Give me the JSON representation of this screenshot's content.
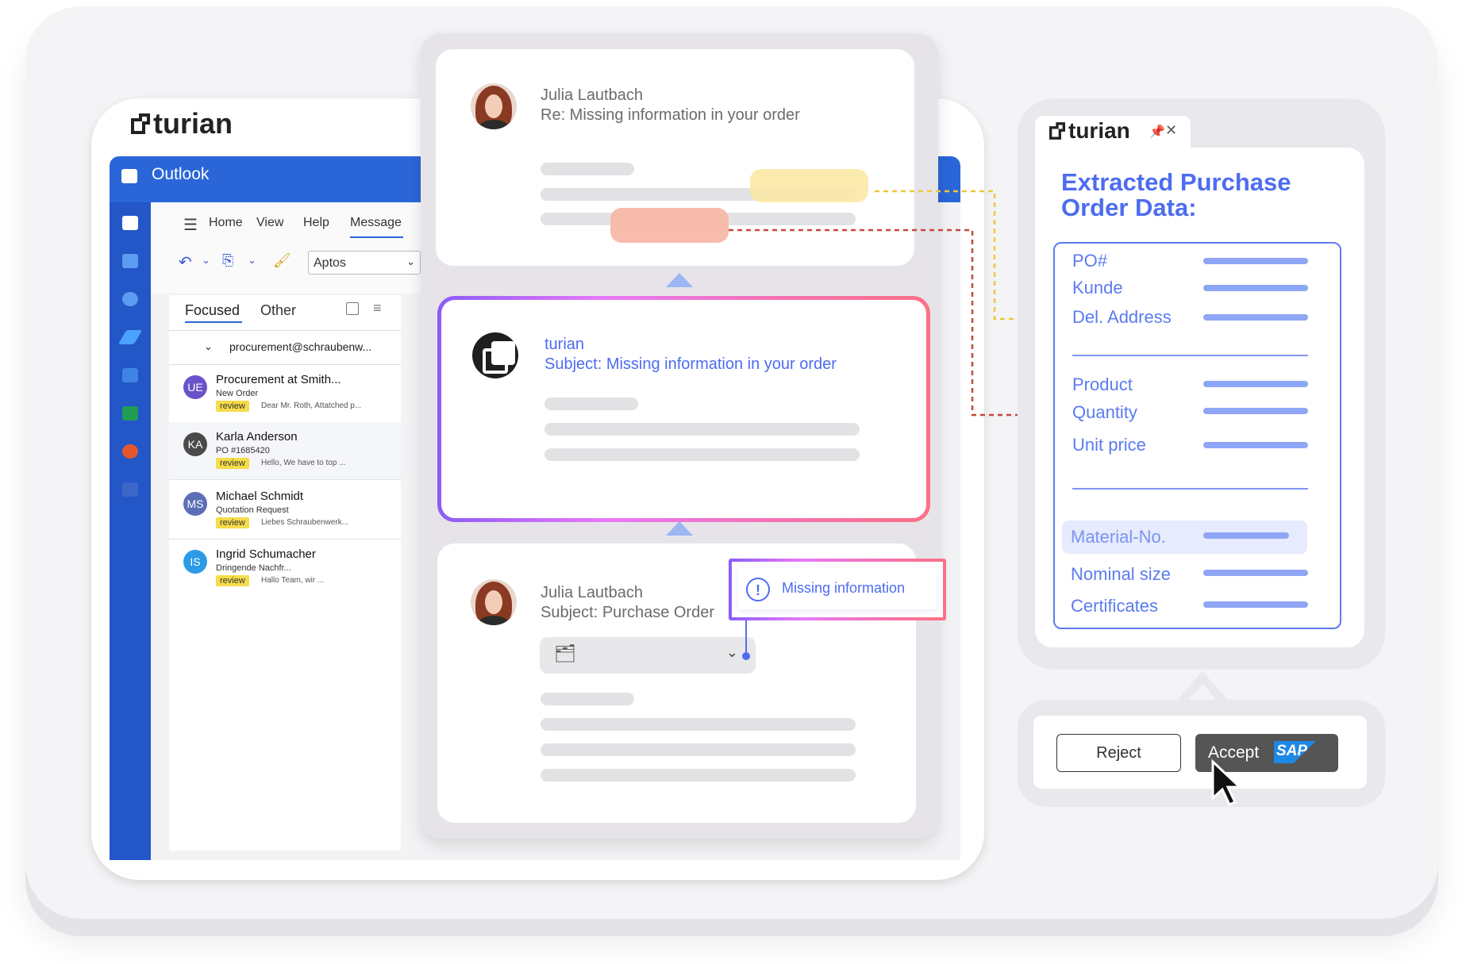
{
  "left_brand": "turian",
  "outlook": {
    "title": "Outlook",
    "menu": [
      "Home",
      "View",
      "Help",
      "Message"
    ],
    "font": "Aptos",
    "tabs": {
      "focused": "Focused",
      "other": "Other"
    },
    "folder": "procurement@schraubenw...",
    "mails": [
      {
        "initials": "UE",
        "color": "#6a52c9",
        "name": "Procurement at Smith...",
        "subject": "New Order",
        "tag": "review",
        "preview": "Dear Mr. Roth, Attatched p..."
      },
      {
        "initials": "KA",
        "color": "#4a4a4a",
        "name": "Karla Anderson",
        "subject": "PO #1685420",
        "tag": "review",
        "preview": "Hello, We have to top ..."
      },
      {
        "initials": "MS",
        "color": "#5b6fb5",
        "name": "Michael Schmidt",
        "subject": "Quotation Request",
        "tag": "review",
        "preview": "Liebes Schraubenwerk..."
      },
      {
        "initials": "IS",
        "color": "#2b9be6",
        "name": "Ingrid Schumacher",
        "subject": "Dringende Nachfr...",
        "tag": "review",
        "preview": "Hallo Team, wir ..."
      }
    ]
  },
  "cards": {
    "first": {
      "sender": "Julia Lautbach",
      "subject": "Re: Missing information in your order"
    },
    "second": {
      "sender": "turian",
      "subject": "Subject: Missing information in your order"
    },
    "third": {
      "sender": "Julia Lautbach",
      "subject": "Subject: Purchase Order"
    }
  },
  "missing_info": "Missing information",
  "right_panel": {
    "brand": "turian",
    "title": "Extracted Purchase Order Data:",
    "fields": [
      "PO#",
      "Kunde",
      "Del. Address",
      "Product",
      "Quantity",
      "Unit price",
      "Material-No.",
      "Nominal size",
      "Certificates"
    ]
  },
  "actions": {
    "reject": "Reject",
    "accept": "Accept",
    "sap": "SAP"
  },
  "colors": {
    "accent": "#4d6cf0",
    "outlook_blue": "#2b66d9",
    "yellow_highlight": "#fbe9a6",
    "red_highlight": "#f8b8a8"
  }
}
